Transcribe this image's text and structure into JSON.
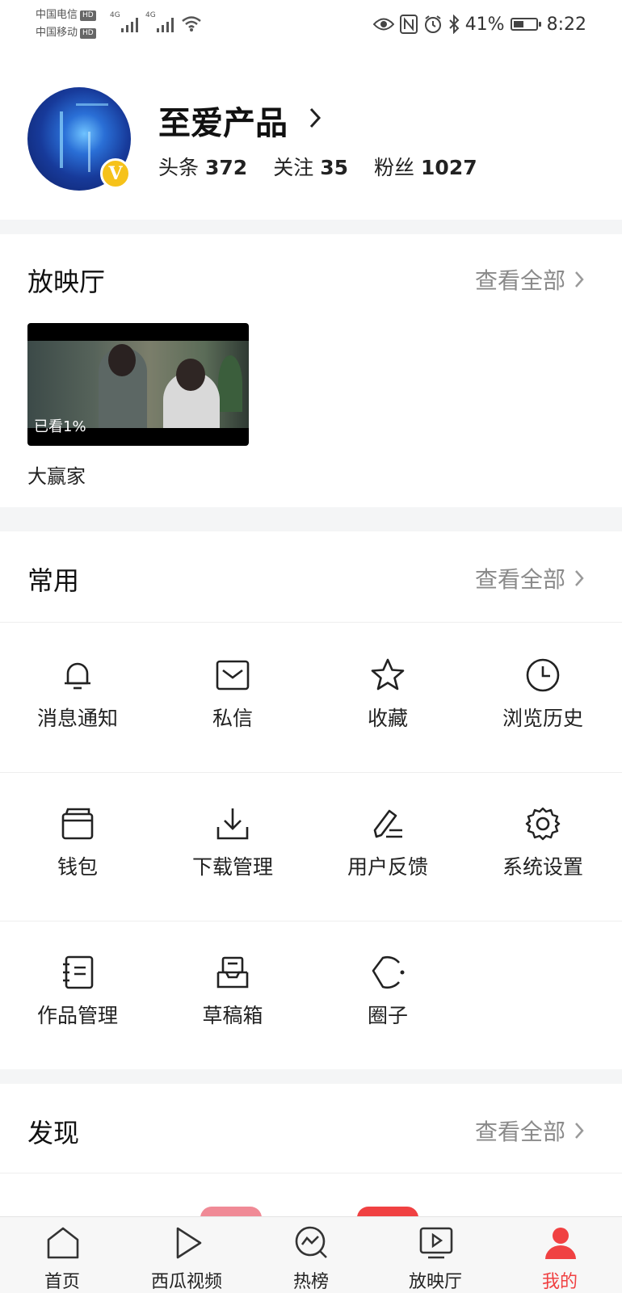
{
  "status_bar": {
    "carrier1": "中国电信",
    "carrier2": "中国移动",
    "hd": "HD",
    "network": "4G",
    "battery": "41%",
    "time": "8:22"
  },
  "profile": {
    "name": "至爱产品",
    "stats": [
      {
        "label": "头条",
        "value": "372"
      },
      {
        "label": "关注",
        "value": "35"
      },
      {
        "label": "粉丝",
        "value": "1027"
      }
    ],
    "badge": "V"
  },
  "theater": {
    "title": "放映厅",
    "more": "查看全部",
    "items": [
      {
        "name": "大赢家",
        "progress": "已看1%"
      }
    ]
  },
  "common": {
    "title": "常用",
    "more": "查看全部",
    "items": [
      {
        "label": "消息通知",
        "icon": "bell-icon"
      },
      {
        "label": "私信",
        "icon": "mail-icon"
      },
      {
        "label": "收藏",
        "icon": "star-icon"
      },
      {
        "label": "浏览历史",
        "icon": "clock-icon"
      },
      {
        "label": "钱包",
        "icon": "wallet-icon"
      },
      {
        "label": "下载管理",
        "icon": "download-icon"
      },
      {
        "label": "用户反馈",
        "icon": "pencil-icon"
      },
      {
        "label": "系统设置",
        "icon": "gear-icon"
      },
      {
        "label": "作品管理",
        "icon": "notebook-icon"
      },
      {
        "label": "草稿箱",
        "icon": "drafts-icon"
      },
      {
        "label": "圈子",
        "icon": "circle-icon"
      }
    ]
  },
  "discover": {
    "title": "发现",
    "more": "查看全部"
  },
  "tabbar": {
    "items": [
      {
        "label": "首页",
        "icon": "home-icon"
      },
      {
        "label": "西瓜视频",
        "icon": "play-icon"
      },
      {
        "label": "热榜",
        "icon": "trending-icon"
      },
      {
        "label": "放映厅",
        "icon": "tv-icon"
      },
      {
        "label": "我的",
        "icon": "person-icon"
      }
    ],
    "active_index": 4,
    "active_color": "#f04142"
  }
}
